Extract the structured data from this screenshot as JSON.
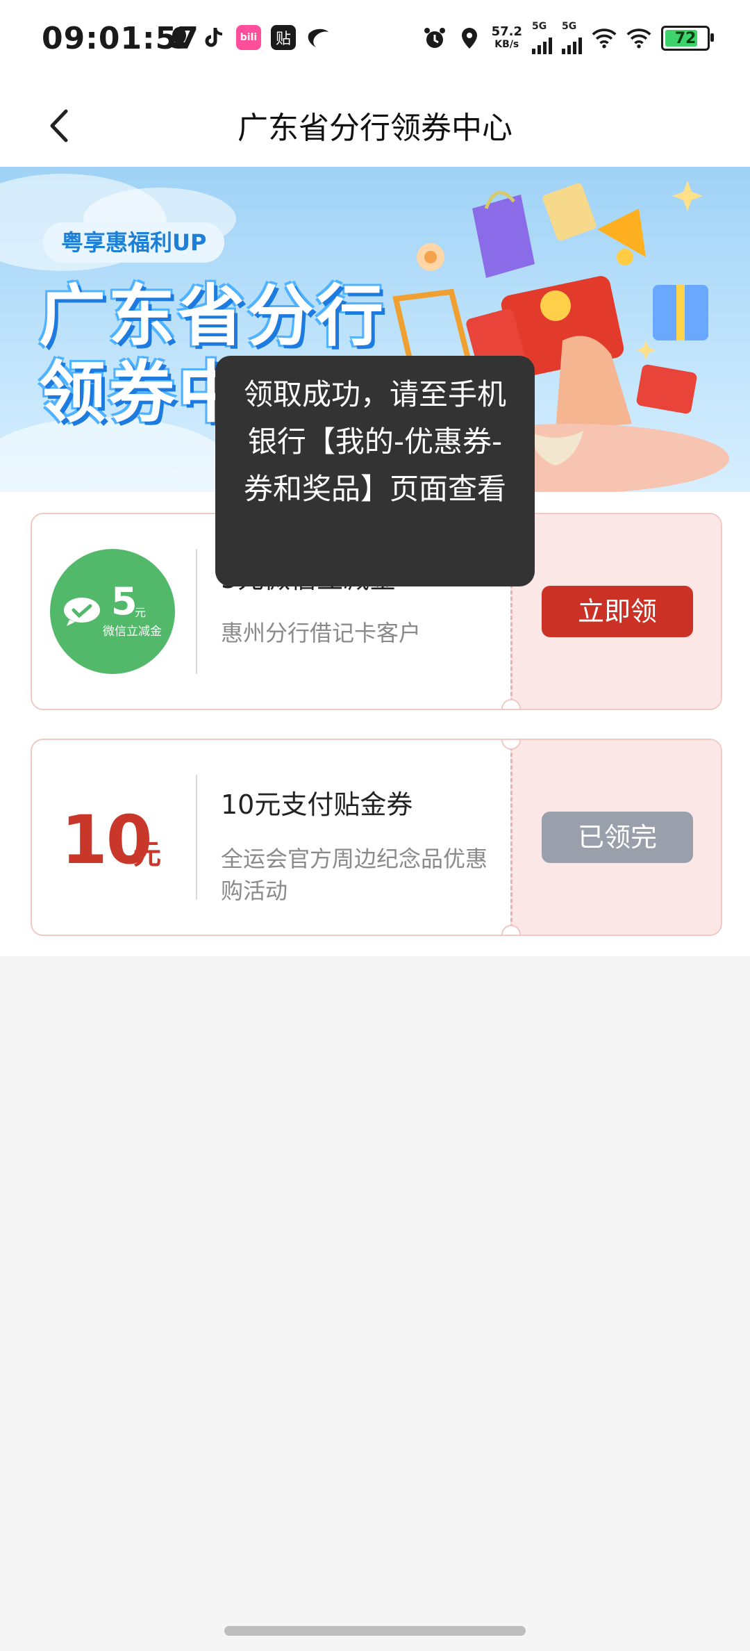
{
  "status_bar": {
    "time": "09:01:57",
    "net_speed_value": "57.2",
    "net_speed_unit": "KB/s",
    "signal1_label": "5G",
    "signal2_label": "5G",
    "battery": "72",
    "battery_level": 0.72,
    "left_icons": [
      "qq-icon",
      "tiktok-icon",
      "bilibili-icon",
      "tieba-icon",
      "china-telecom-icon"
    ],
    "right_icons": [
      "alarm-icon",
      "location-icon",
      "wifi-icon",
      "wifi-icon"
    ],
    "tieba_glyph": "贴"
  },
  "nav": {
    "title": "广东省分行领券中心",
    "back_icon": "chevron-left-icon"
  },
  "banner": {
    "chip": "粤享惠福利UP",
    "title_line1": "广东省分行",
    "title_line2": "领券中心"
  },
  "coupons": [
    {
      "badge_amount": "5",
      "badge_unit": "元",
      "badge_label": "微信立减金",
      "title": "5元微信立减金",
      "desc": "惠州分行借记卡客户",
      "button": "立即领",
      "button_color": "#cc3125"
    },
    {
      "amount": "10",
      "unit": "元",
      "title": "10元支付贴金券",
      "desc": "全运会官方周边纪念品优惠购活动",
      "button": "已领完",
      "button_color": "#9aa0ab"
    }
  ],
  "toast": {
    "text": "领取成功，请至手机银行【我的-优惠券-券和奖品】页面查看"
  },
  "colors": {
    "accent_red": "#c9372b",
    "coupon_border": "#f0c8c4",
    "wechat_green": "#52b86a",
    "toast_bg": "#333333"
  }
}
